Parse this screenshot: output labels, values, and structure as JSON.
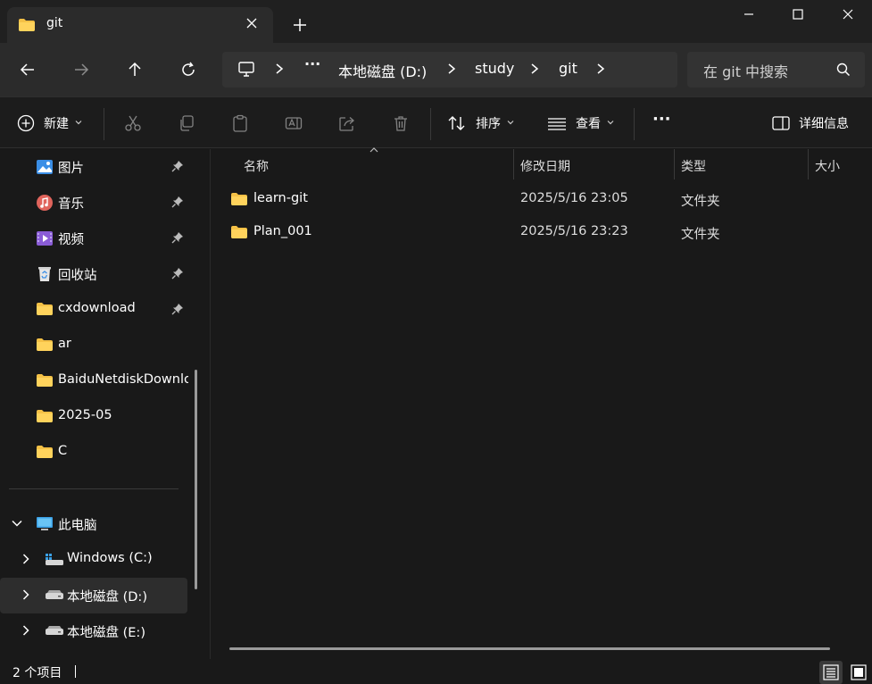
{
  "tab": {
    "title": "git"
  },
  "address": {
    "crumbs": [
      "本地磁盘 (D:)",
      "study",
      "git"
    ],
    "ellipsis": "···"
  },
  "search": {
    "placeholder": "在 git 中搜索"
  },
  "toolbar": {
    "new_label": "新建",
    "sort_label": "排序",
    "view_label": "查看",
    "more_label": "···",
    "details_label": "详细信息"
  },
  "sidebar": {
    "pinned": [
      {
        "label": "图片",
        "icon": "pictures-icon"
      },
      {
        "label": "音乐",
        "icon": "music-icon"
      },
      {
        "label": "视频",
        "icon": "videos-icon"
      },
      {
        "label": "回收站",
        "icon": "recycle-bin-icon"
      },
      {
        "label": "cxdownload",
        "icon": "folder-icon"
      }
    ],
    "folders": [
      "ar",
      "BaiduNetdiskDownload",
      "2025-05",
      "C"
    ],
    "this_pc": "此电脑",
    "drives": [
      "Windows (C:)",
      "本地磁盘 (D:)",
      "本地磁盘 (E:)"
    ]
  },
  "columns": {
    "name": "名称",
    "modified": "修改日期",
    "type": "类型",
    "size": "大小"
  },
  "files": [
    {
      "name": "learn-git",
      "modified": "2025/5/16 23:05",
      "type": "文件夹"
    },
    {
      "name": "Plan_001",
      "modified": "2025/5/16 23:23",
      "type": "文件夹"
    }
  ],
  "status": {
    "count": "2 个项目"
  },
  "colors": {
    "folder": "#f5c146",
    "accent": "#4cc2ff"
  }
}
